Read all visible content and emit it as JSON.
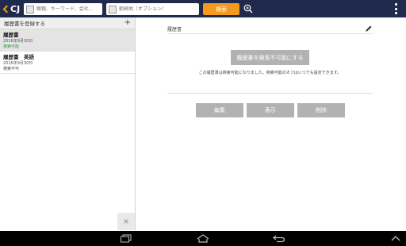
{
  "header": {
    "logo_text": "CJ",
    "keyword_placeholder": "職種、キーワード、会社…",
    "location_placeholder": "勤務地（オプション）",
    "search_label": "検索",
    "icons": [
      "chevron-logo-icon",
      "location-icon",
      "zoom-search-icon",
      "overflow-menu-icon"
    ]
  },
  "sidebar": {
    "header_title": "履歴書を登録する",
    "add_label": "+",
    "items": [
      {
        "name": "履歴書",
        "date": "2016年9月30日",
        "status": "検索可能",
        "selected": true
      },
      {
        "name": "履歴書　英語",
        "date": "2016年9月30日",
        "status": "検索不可",
        "selected": false
      }
    ],
    "close_label": "×"
  },
  "main": {
    "title": "履歴書",
    "toggle_label": "履歴書を検索不可能にする",
    "note": "この履歴書は検索可能になりました。検索可能のオフはいつでも設定できます。",
    "buttons": {
      "edit": "編集",
      "view": "表示",
      "delete": "削除"
    }
  },
  "colors": {
    "topbar": "#1f2a4d",
    "accent": "#f39a1f",
    "searchable": "#3a9a3a",
    "disabled_button": "#b2b2b2"
  }
}
